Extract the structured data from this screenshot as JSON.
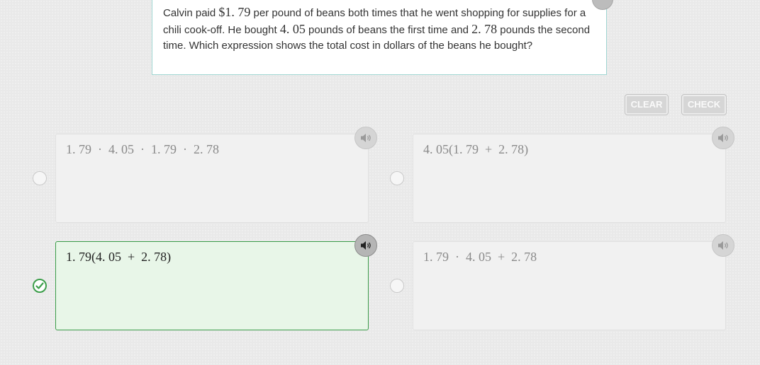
{
  "question": {
    "segments": [
      {
        "text": "Calvin paid ",
        "math": false
      },
      {
        "text": "$1. 79",
        "math": true
      },
      {
        "text": " per pound of beans both times that he went shopping for supplies for a chili cook-off. He bought ",
        "math": false
      },
      {
        "text": "4. 05",
        "math": true
      },
      {
        "text": " pounds of beans the first time and ",
        "math": false
      },
      {
        "text": "2. 78",
        "math": true
      },
      {
        "text": " pounds the second time. Which expression shows the total cost in dollars of the beans he bought?",
        "math": false
      }
    ]
  },
  "buttons": {
    "clear": "CLEAR",
    "check": "CHECK"
  },
  "choices": [
    {
      "expression": "1. 79  ·  4. 05  ·  1. 79  ·  2. 78",
      "selected": false
    },
    {
      "expression": "4. 05(1. 79  +  2. 78)",
      "selected": false
    },
    {
      "expression": "1. 79(4. 05  +  2. 78)",
      "selected": true
    },
    {
      "expression": "1. 79  ·  4. 05  +  2. 78",
      "selected": false
    }
  ],
  "icons": {
    "audio": "speaker-icon",
    "selected_mark": "checkmark-icon"
  },
  "colors": {
    "accent_green": "#3c9e4a",
    "selected_bg": "#e8f6e8",
    "question_border": "#9fd6d2"
  }
}
